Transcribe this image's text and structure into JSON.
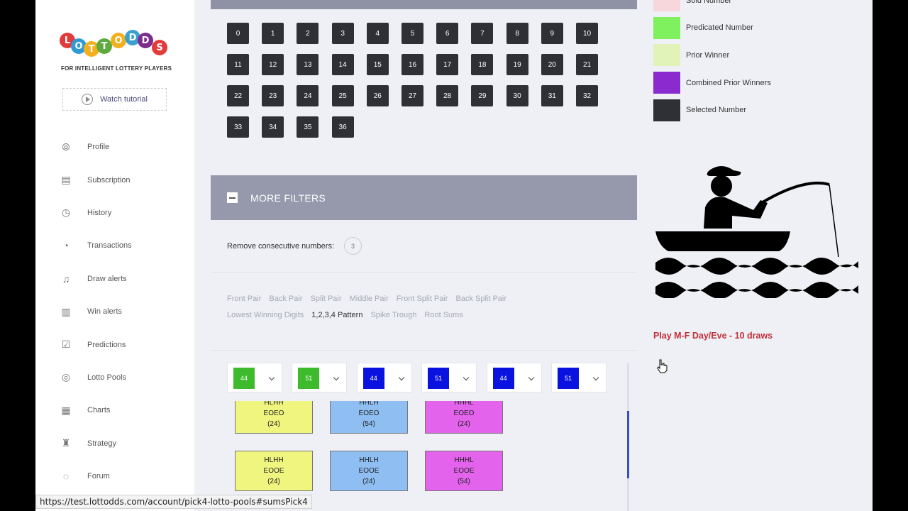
{
  "brand": {
    "logo_letters": [
      "L",
      "O",
      "T",
      "T",
      "O",
      "D",
      "D",
      "S"
    ],
    "logo_colors": [
      "#e23b3b",
      "#2f9bd6",
      "#f2b01e",
      "#5dab3e",
      "#f2b01e",
      "#3aa0d0",
      "#7d2b8d",
      "#e23b3b"
    ],
    "tagline": "FOR INTELLIGENT LOTTERY PLAYERS"
  },
  "tutorial": {
    "label": "Watch tutorial"
  },
  "nav": [
    {
      "label": "Profile",
      "icon": "fingerprint-icon",
      "glyph": "⦾"
    },
    {
      "label": "Subscription",
      "icon": "receipt-icon",
      "glyph": "▤"
    },
    {
      "label": "History",
      "icon": "history-icon",
      "glyph": "◷"
    },
    {
      "label": "Transactions",
      "icon": "transactions-icon",
      "glyph": "◔"
    },
    {
      "label": "Draw alerts",
      "icon": "bell-icon",
      "glyph": "♫"
    },
    {
      "label": "Win alerts",
      "icon": "win-alert-icon",
      "glyph": "▥"
    },
    {
      "label": "Predictions",
      "icon": "checkbox-icon",
      "glyph": "☑"
    },
    {
      "label": "Lotto Pools",
      "icon": "coins-icon",
      "glyph": "◎"
    },
    {
      "label": "Charts",
      "icon": "chart-file-icon",
      "glyph": "▦"
    },
    {
      "label": "Strategy",
      "icon": "chess-icon",
      "glyph": "♜"
    },
    {
      "label": "Forum",
      "icon": "chat-icon",
      "glyph": "◌"
    }
  ],
  "numbers": [
    "0",
    "1",
    "2",
    "3",
    "4",
    "5",
    "6",
    "7",
    "8",
    "9",
    "10",
    "11",
    "12",
    "13",
    "14",
    "15",
    "16",
    "17",
    "18",
    "19",
    "20",
    "21",
    "22",
    "23",
    "24",
    "25",
    "26",
    "27",
    "28",
    "29",
    "30",
    "31",
    "32",
    "33",
    "34",
    "35",
    "36"
  ],
  "filters": {
    "title": "MORE FILTERS",
    "consecutive_label": "Remove consecutive numbers:",
    "consecutive_value": "3",
    "tabs": [
      "Front Pair",
      "Back Pair",
      "Split Pair",
      "Middle Pair",
      "Front Split Pair",
      "Back Split Pair",
      "Lowest Winning Digits",
      "1,2,3,4 Pattern",
      "Spike Trough",
      "Root Sums"
    ],
    "active_tab": "1,2,3,4 Pattern"
  },
  "selects": [
    {
      "value": "44",
      "color": "#3dbb2c"
    },
    {
      "value": "51",
      "color": "#3dbb2c"
    },
    {
      "value": "44",
      "color": "#0a12e0"
    },
    {
      "value": "51",
      "color": "#0a12e0"
    },
    {
      "value": "44",
      "color": "#0a12e0"
    },
    {
      "value": "51",
      "color": "#0a12e0"
    }
  ],
  "cards": [
    {
      "l1": "HLHH",
      "l2": "EOEO",
      "l3": "(24)",
      "color": "#f0f57f"
    },
    {
      "l1": "HHLH",
      "l2": "EOEO",
      "l3": "(54)",
      "color": "#8fbff2"
    },
    {
      "l1": "HHHL",
      "l2": "EOEO",
      "l3": "(24)",
      "color": "#e463ec"
    },
    {
      "l1": "HLHH",
      "l2": "EOOE",
      "l3": "(24)",
      "color": "#f0f57f"
    },
    {
      "l1": "HHLH",
      "l2": "EOOE",
      "l3": "(24)",
      "color": "#8fbff2"
    },
    {
      "l1": "HHHL",
      "l2": "EOOE",
      "l3": "(54)",
      "color": "#e463ec"
    }
  ],
  "legend": [
    {
      "label": "Sold Number",
      "color": "#f7d6dc"
    },
    {
      "label": "Predicated Number",
      "color": "#7ff05e"
    },
    {
      "label": "Prior Winner",
      "color": "#e1f3b8"
    },
    {
      "label": "Combined Prior Winners",
      "color": "#8a2bd0"
    },
    {
      "label": "Selected Number",
      "color": "#2f3036"
    }
  ],
  "play_text": "Play M-F Day/Eve - 10 draws",
  "status_url": "https://test.lottodds.com/account/pick4-lotto-pools#sumsPick4"
}
